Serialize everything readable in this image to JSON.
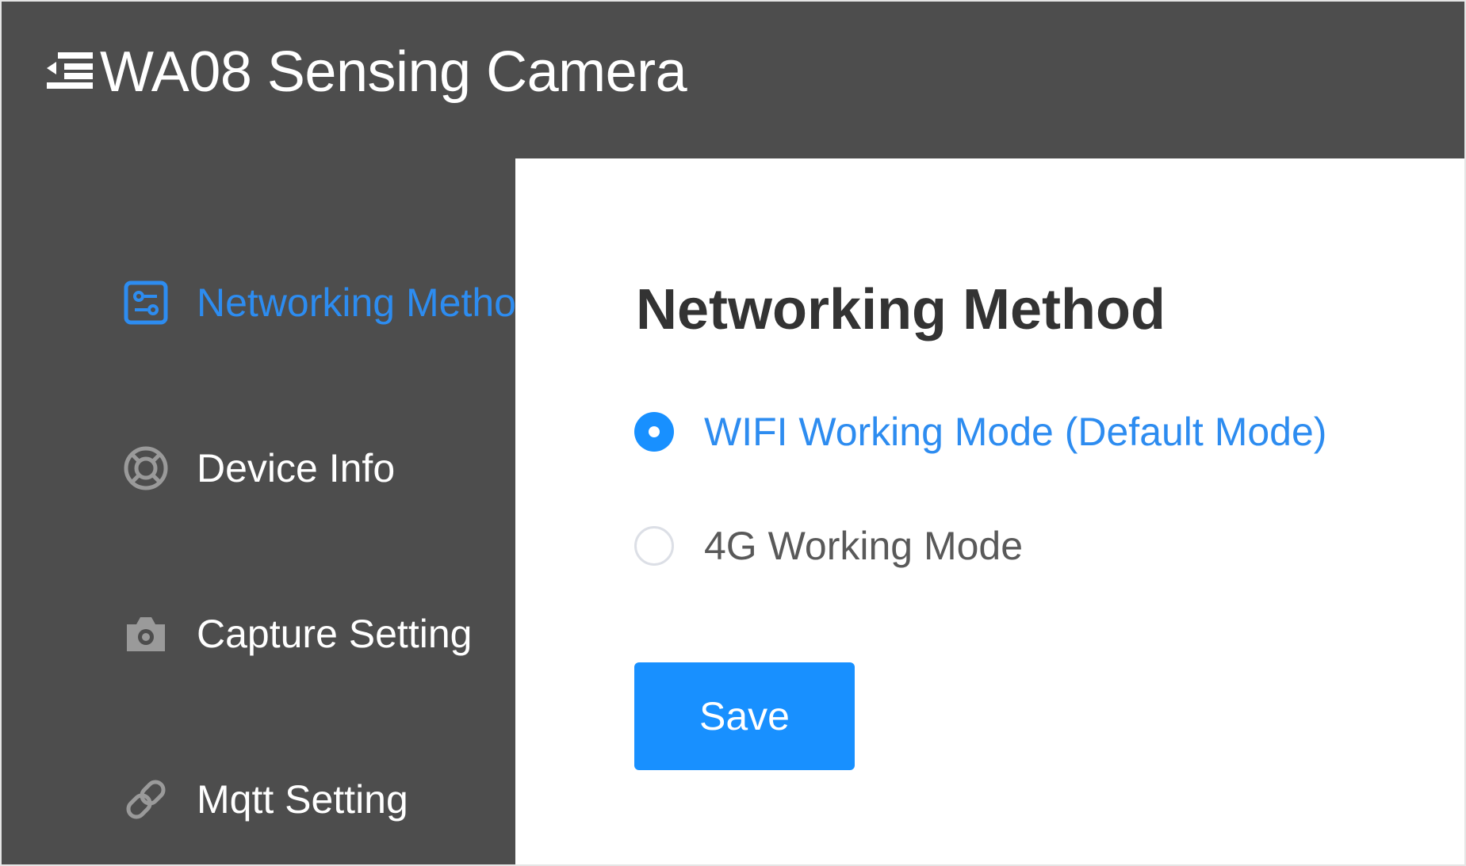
{
  "header": {
    "title": "WA08 Sensing Camera",
    "menu_icon": "menu-fold-icon"
  },
  "sidebar": {
    "items": [
      {
        "label": "Networking Method",
        "icon": "settings-panel-icon",
        "active": true
      },
      {
        "label": "Device Info",
        "icon": "lifebuoy-icon",
        "active": false
      },
      {
        "label": "Capture Setting",
        "icon": "camera-icon",
        "active": false
      },
      {
        "label": "Mqtt Setting",
        "icon": "link-icon",
        "active": false
      }
    ]
  },
  "main": {
    "title": "Networking Method",
    "options": [
      {
        "label": "WIFI Working Mode (Default Mode)",
        "checked": true
      },
      {
        "label": "4G Working Mode",
        "checked": false
      }
    ],
    "save_label": "Save"
  },
  "colors": {
    "header_bg": "#4d4d4d",
    "accent": "#1890ff",
    "active_text": "#2d8cf0",
    "sidebar_icon": "#9a9a9a"
  }
}
